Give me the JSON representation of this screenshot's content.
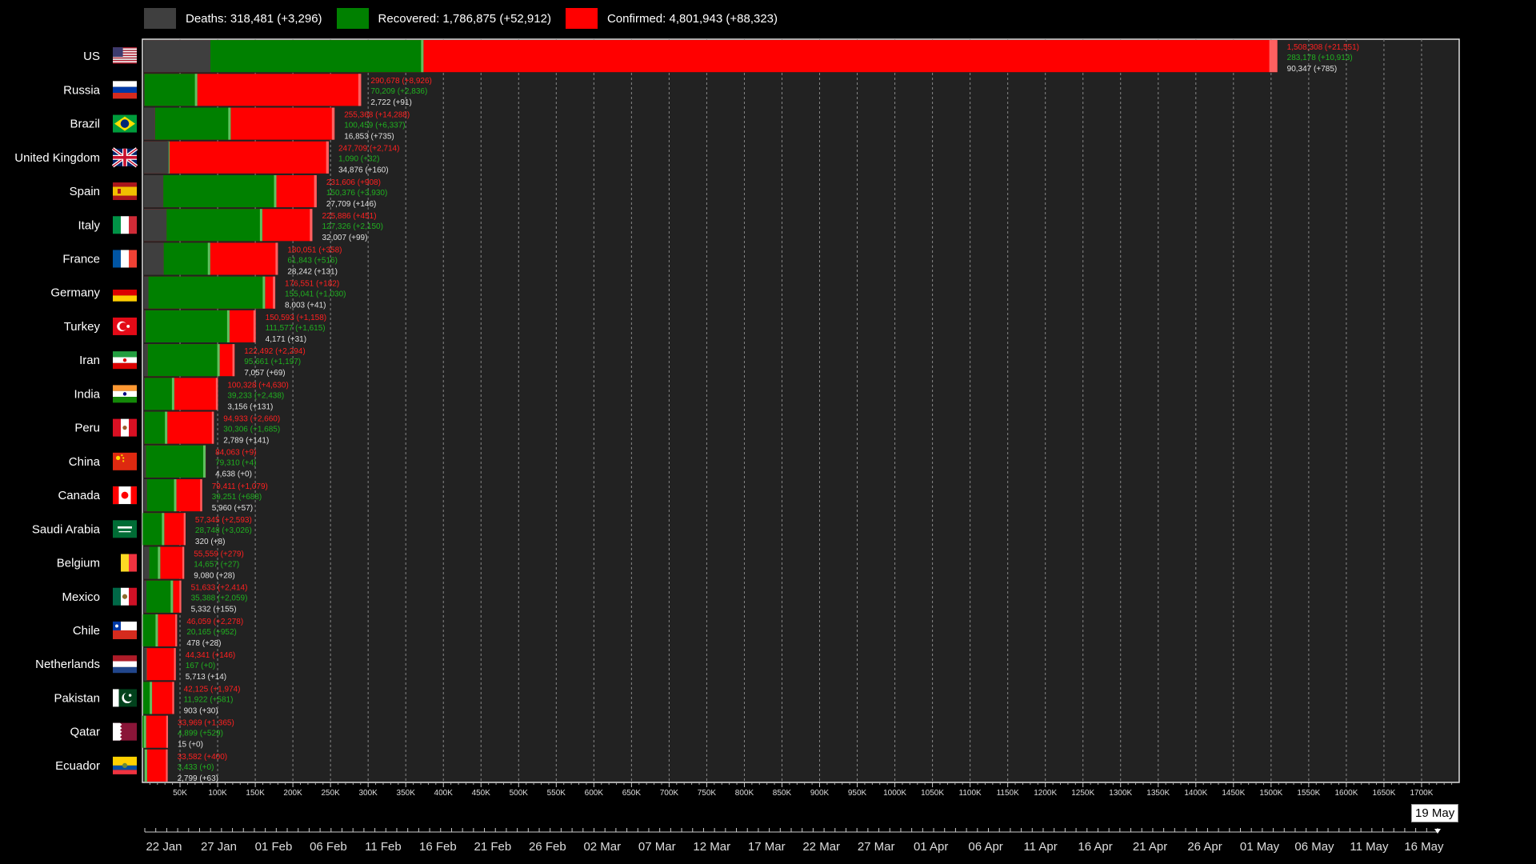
{
  "legend": {
    "deaths": {
      "label": "Deaths: 318,481 (+3,296)",
      "color": "#3f3f3f"
    },
    "recovered": {
      "label": "Recovered: 1,786,875 (+52,912)",
      "color": "#008000"
    },
    "confirmed": {
      "label": "Confirmed: 4,801,943 (+88,323)",
      "color": "#ff0000"
    }
  },
  "current_date": "19 May",
  "chart_data": {
    "type": "bar",
    "orientation": "horizontal",
    "stacked_overlay": true,
    "xlim": [
      0,
      1750000
    ],
    "xticks": [
      "50K",
      "100K",
      "150K",
      "200K",
      "250K",
      "300K",
      "350K",
      "400K",
      "450K",
      "500K",
      "550K",
      "600K",
      "650K",
      "700K",
      "750K",
      "800K",
      "850K",
      "900K",
      "950K",
      "1000K",
      "1050K",
      "1100K",
      "1150K",
      "1200K",
      "1250K",
      "1300K",
      "1350K",
      "1400K",
      "1450K",
      "1500K",
      "1550K",
      "1600K",
      "1650K",
      "1700K"
    ],
    "timeline_ticks": [
      "22 Jan",
      "27 Jan",
      "01 Feb",
      "06 Feb",
      "11 Feb",
      "16 Feb",
      "21 Feb",
      "26 Feb",
      "02 Mar",
      "07 Mar",
      "12 Mar",
      "17 Mar",
      "22 Mar",
      "27 Mar",
      "01 Apr",
      "06 Apr",
      "11 Apr",
      "16 Apr",
      "21 Apr",
      "26 Apr",
      "01 May",
      "06 May",
      "11 May",
      "16 May"
    ],
    "timeline_position": 1.0,
    "countries": [
      {
        "name": "US",
        "flag": "us",
        "confirmed": 1508308,
        "confirmed_label": "1,508,308 (+21,551)",
        "recovered": 283178,
        "recovered_label": "283,178 (+10,913)",
        "deaths": 90347,
        "deaths_label": "90,347 (+785)"
      },
      {
        "name": "Russia",
        "flag": "russia",
        "confirmed": 290678,
        "confirmed_label": "290,678 (+8,926)",
        "recovered": 70209,
        "recovered_label": "70,209 (+2,836)",
        "deaths": 2722,
        "deaths_label": "2,722 (+91)"
      },
      {
        "name": "Brazil",
        "flag": "brazil",
        "confirmed": 255368,
        "confirmed_label": "255,368 (+14,288)",
        "recovered": 100459,
        "recovered_label": "100,459 (+6,337)",
        "deaths": 16853,
        "deaths_label": "16,853 (+735)"
      },
      {
        "name": "United Kingdom",
        "flag": "uk",
        "confirmed": 247709,
        "confirmed_label": "247,709 (+2,714)",
        "recovered": 1090,
        "recovered_label": "1,090 (+32)",
        "deaths": 34876,
        "deaths_label": "34,876 (+160)"
      },
      {
        "name": "Spain",
        "flag": "spain",
        "confirmed": 231606,
        "confirmed_label": "231,606 (+908)",
        "recovered": 150376,
        "recovered_label": "150,376 (+3,930)",
        "deaths": 27709,
        "deaths_label": "27,709 (+146)"
      },
      {
        "name": "Italy",
        "flag": "italy",
        "confirmed": 225886,
        "confirmed_label": "225,886 (+451)",
        "recovered": 127326,
        "recovered_label": "127,326 (+2,150)",
        "deaths": 32007,
        "deaths_label": "32,007 (+99)"
      },
      {
        "name": "France",
        "flag": "france",
        "confirmed": 180051,
        "confirmed_label": "180,051 (+358)",
        "recovered": 61843,
        "recovered_label": "61,843 (+516)",
        "deaths": 28242,
        "deaths_label": "28,242 (+131)"
      },
      {
        "name": "Germany",
        "flag": "germany",
        "confirmed": 176551,
        "confirmed_label": "176,551 (+182)",
        "recovered": 155041,
        "recovered_label": "155,041 (+1,030)",
        "deaths": 8003,
        "deaths_label": "8,003 (+41)"
      },
      {
        "name": "Turkey",
        "flag": "turkey",
        "confirmed": 150593,
        "confirmed_label": "150,593 (+1,158)",
        "recovered": 111577,
        "recovered_label": "111,577 (+1,615)",
        "deaths": 4171,
        "deaths_label": "4,171 (+31)"
      },
      {
        "name": "Iran",
        "flag": "iran",
        "confirmed": 122492,
        "confirmed_label": "122,492 (+2,294)",
        "recovered": 95661,
        "recovered_label": "95,661 (+1,197)",
        "deaths": 7057,
        "deaths_label": "7,057 (+69)"
      },
      {
        "name": "India",
        "flag": "india",
        "confirmed": 100328,
        "confirmed_label": "100,328 (+4,630)",
        "recovered": 39233,
        "recovered_label": "39,233 (+2,438)",
        "deaths": 3156,
        "deaths_label": "3,156 (+131)"
      },
      {
        "name": "Peru",
        "flag": "peru",
        "confirmed": 94933,
        "confirmed_label": "94,933 (+2,660)",
        "recovered": 30306,
        "recovered_label": "30,306 (+1,685)",
        "deaths": 2789,
        "deaths_label": "2,789 (+141)"
      },
      {
        "name": "China",
        "flag": "china",
        "confirmed": 84063,
        "confirmed_label": "84,063 (+9)",
        "recovered": 79310,
        "recovered_label": "79,310 (+4)",
        "deaths": 4638,
        "deaths_label": "4,638 (+0)"
      },
      {
        "name": "Canada",
        "flag": "canada",
        "confirmed": 79411,
        "confirmed_label": "79,411 (+1,079)",
        "recovered": 39251,
        "recovered_label": "39,251 (+688)",
        "deaths": 5960,
        "deaths_label": "5,960 (+57)"
      },
      {
        "name": "Saudi Arabia",
        "flag": "saudi",
        "confirmed": 57345,
        "confirmed_label": "57,345 (+2,593)",
        "recovered": 28748,
        "recovered_label": "28,748 (+3,026)",
        "deaths": 320,
        "deaths_label": "320 (+8)"
      },
      {
        "name": "Belgium",
        "flag": "belgium",
        "confirmed": 55559,
        "confirmed_label": "55,559 (+279)",
        "recovered": 14657,
        "recovered_label": "14,657 (+27)",
        "deaths": 9080,
        "deaths_label": "9,080 (+28)"
      },
      {
        "name": "Mexico",
        "flag": "mexico",
        "confirmed": 51633,
        "confirmed_label": "51,633 (+2,414)",
        "recovered": 35388,
        "recovered_label": "35,388 (+2,059)",
        "deaths": 5332,
        "deaths_label": "5,332 (+155)"
      },
      {
        "name": "Chile",
        "flag": "chile",
        "confirmed": 46059,
        "confirmed_label": "46,059 (+2,278)",
        "recovered": 20165,
        "recovered_label": "20,165 (+952)",
        "deaths": 478,
        "deaths_label": "478 (+28)"
      },
      {
        "name": "Netherlands",
        "flag": "netherlands",
        "confirmed": 44341,
        "confirmed_label": "44,341 (+146)",
        "recovered": 167,
        "recovered_label": "167 (+0)",
        "deaths": 5713,
        "deaths_label": "5,713 (+14)"
      },
      {
        "name": "Pakistan",
        "flag": "pakistan",
        "confirmed": 42125,
        "confirmed_label": "42,125 (+1,974)",
        "recovered": 11922,
        "recovered_label": "11,922 (+581)",
        "deaths": 903,
        "deaths_label": "903 (+30)"
      },
      {
        "name": "Qatar",
        "flag": "qatar",
        "confirmed": 33969,
        "confirmed_label": "33,969 (+1,365)",
        "recovered": 4899,
        "recovered_label": "4,899 (+529)",
        "deaths": 15,
        "deaths_label": "15 (+0)"
      },
      {
        "name": "Ecuador",
        "flag": "ecuador",
        "confirmed": 33582,
        "confirmed_label": "33,582 (+400)",
        "recovered": 3433,
        "recovered_label": "3,433 (+0)",
        "deaths": 2799,
        "deaths_label": "2,799 (+63)"
      }
    ]
  }
}
